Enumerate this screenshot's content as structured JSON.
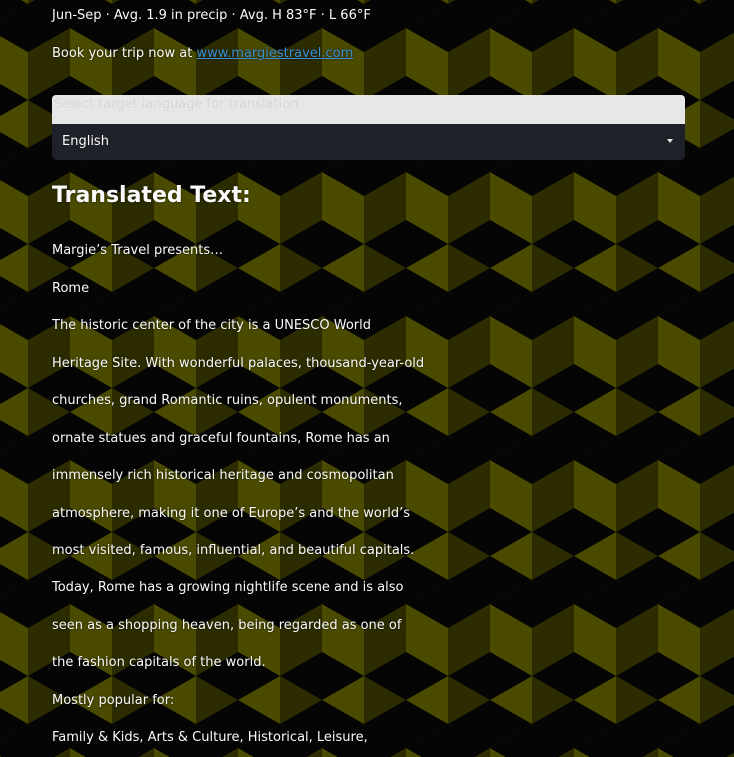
{
  "info": {
    "season_line": "Jun-Sep · Avg. 1.9 in precip · Avg. H 83°F · L 66°F",
    "book_prefix": "Book your trip now at ",
    "book_link": "www.margiestravel.com"
  },
  "language_select": {
    "label": "Select target language for translation",
    "value": "English"
  },
  "translated": {
    "heading": "Translated Text:",
    "lines": [
      "Margie’s Travel presents…",
      "Rome",
      "The historic center of the city is a UNESCO World",
      "Heritage Site. With wonderful palaces, thousand-year-old",
      "churches, grand Romantic ruins, opulent monuments,",
      "ornate statues and graceful fountains, Rome has an",
      "immensely rich historical heritage and cosmopolitan",
      "atmosphere, making it one of Europe’s and the world’s",
      "most visited, famous, influential, and beautiful capitals.",
      "Today, Rome has a growing nightlife scene and is also",
      "seen as a shopping heaven, being regarded as one of",
      "the fashion capitals of the world.",
      "Mostly popular for:",
      "Family & Kids, Arts & Culture, Historical, Leisure,"
    ]
  },
  "colors": {
    "pattern_olive": "#4a4a00",
    "pattern_dark": "#050505",
    "pattern_mid": "#2a2a00",
    "link": "#3a8fd6"
  }
}
